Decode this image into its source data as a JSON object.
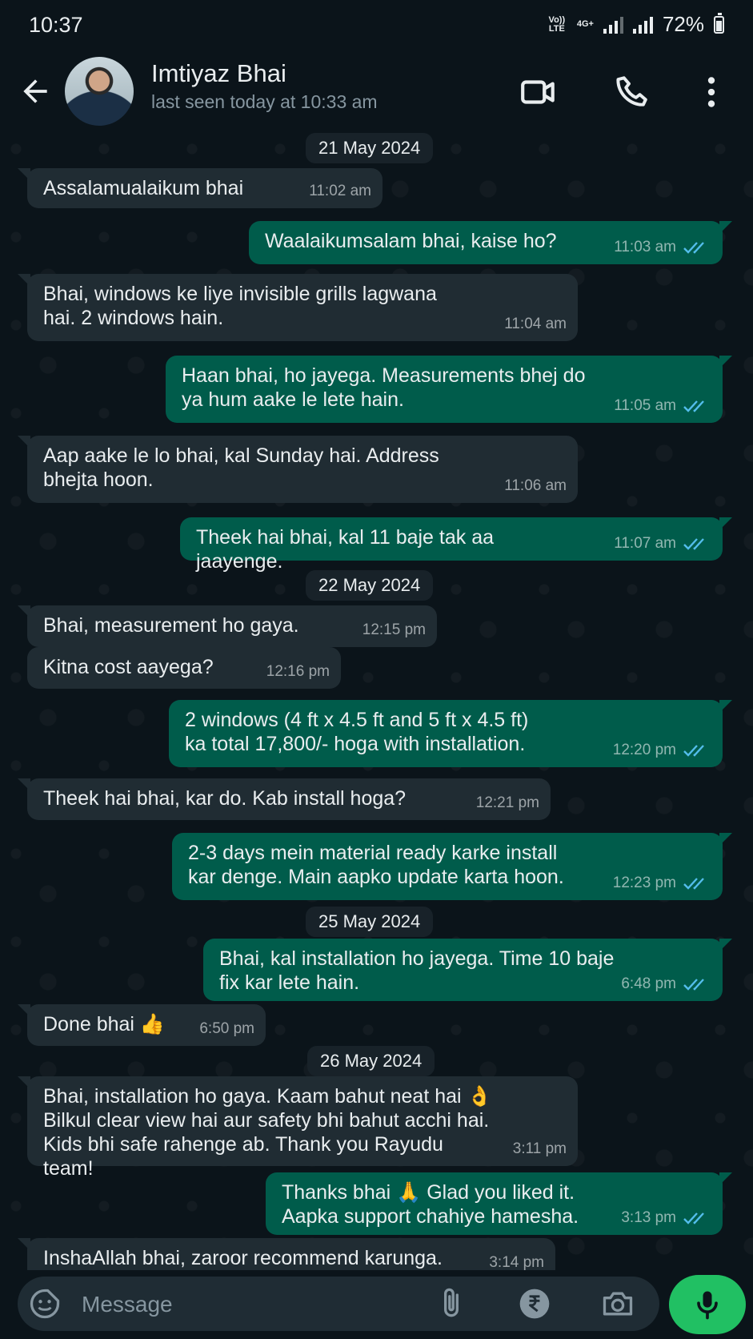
{
  "status_bar": {
    "time": "10:37",
    "network1": "Vo)) LTE",
    "network2": "4G+",
    "battery": "72%"
  },
  "header": {
    "contact_name": "Imtiyaz Bhai",
    "last_seen": "last seen today at 10:33 am"
  },
  "chat": {
    "dates": [
      "21 May 2024",
      "22 May 2024",
      "25 May 2024",
      "26 May 2024"
    ],
    "messages": [
      {
        "text": "Assalamualaikum bhai",
        "time": "11:02 am"
      },
      {
        "text": "Waalaikumsalam bhai, kaise ho?",
        "time": "11:03 am"
      },
      {
        "text": "Bhai, windows ke liye invisible grills lagwana\nhai. 2 windows hain.",
        "time": "11:04 am"
      },
      {
        "text": "Haan bhai, ho jayega. Measurements bhej do\nya hum aake le lete hain.",
        "time": "11:05 am"
      },
      {
        "text": "Aap aake le lo bhai, kal Sunday hai. Address\nbhejta hoon.",
        "time": "11:06 am"
      },
      {
        "text": "Theek hai bhai, kal 11 baje tak aa jaayenge.",
        "time": "11:07 am"
      },
      {
        "text": "Bhai, measurement ho gaya.",
        "time": "12:15 pm"
      },
      {
        "text": "Kitna cost aayega?",
        "time": "12:16 pm"
      },
      {
        "text": "2 windows (4 ft x 4.5 ft and 5 ft x 4.5 ft)\nka total 17,800/- hoga with installation.",
        "time": "12:20 pm"
      },
      {
        "text": "Theek hai bhai, kar do. Kab install hoga?",
        "time": "12:21 pm"
      },
      {
        "text": "2-3 days mein material ready karke install\nkar denge. Main aapko update karta hoon.",
        "time": "12:23 pm"
      },
      {
        "text": "Bhai, kal installation ho jayega. Time 10 baje\nfix kar lete hain.",
        "time": "6:48 pm"
      },
      {
        "text": "Done bhai 👍",
        "time": "6:50 pm"
      },
      {
        "text": "Bhai, installation ho gaya. Kaam bahut neat hai 👌\nBilkul clear view hai aur safety bhi bahut acchi hai.\nKids bhi safe rahenge ab. Thank you Rayudu team!",
        "time": "3:11 pm"
      },
      {
        "text": "Thanks bhai 🙏 Glad you liked it.\nAapka support chahiye hamesha.",
        "time": "3:13 pm"
      },
      {
        "text": "InshaAllah bhai, zaroor recommend karunga.",
        "time": "3:14 pm"
      }
    ]
  },
  "composer": {
    "placeholder": "Message"
  },
  "colors": {
    "background": "#0b141a",
    "incoming": "#202c33",
    "outgoing": "#005c4b",
    "accent": "#21c063",
    "read_ticks": "#53bdeb"
  },
  "icons": [
    "back-arrow-icon",
    "video-call-icon",
    "phone-icon",
    "more-options-icon",
    "emoji-icon",
    "attach-icon",
    "rupee-icon",
    "camera-icon",
    "mic-icon",
    "double-tick-icon"
  ]
}
